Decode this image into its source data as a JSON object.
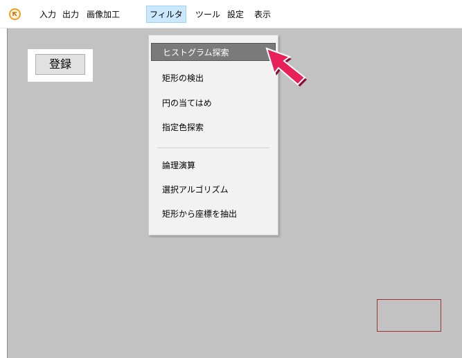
{
  "menubar": {
    "items": [
      "入力",
      "出力",
      "画像加工",
      "フィルタ",
      "ツール",
      "設定",
      "表示"
    ],
    "active": "フィルタ"
  },
  "canvas": {
    "register_button": "登録"
  },
  "dropdown": {
    "items": [
      "ヒストグラム探索",
      "矩形の検出",
      "円の当てはめ",
      "指定色探索",
      "論理演算",
      "選択アルゴリズム",
      "矩形から座標を抽出"
    ],
    "highlighted": "ヒストグラム探索"
  },
  "colors": {
    "canvas_bg": "#c2c2c2",
    "highlight_bg": "#7a7a7a",
    "active_menu_bg": "#cce8ff",
    "cursor": "#e8205a",
    "marker_border": "#a03030"
  }
}
